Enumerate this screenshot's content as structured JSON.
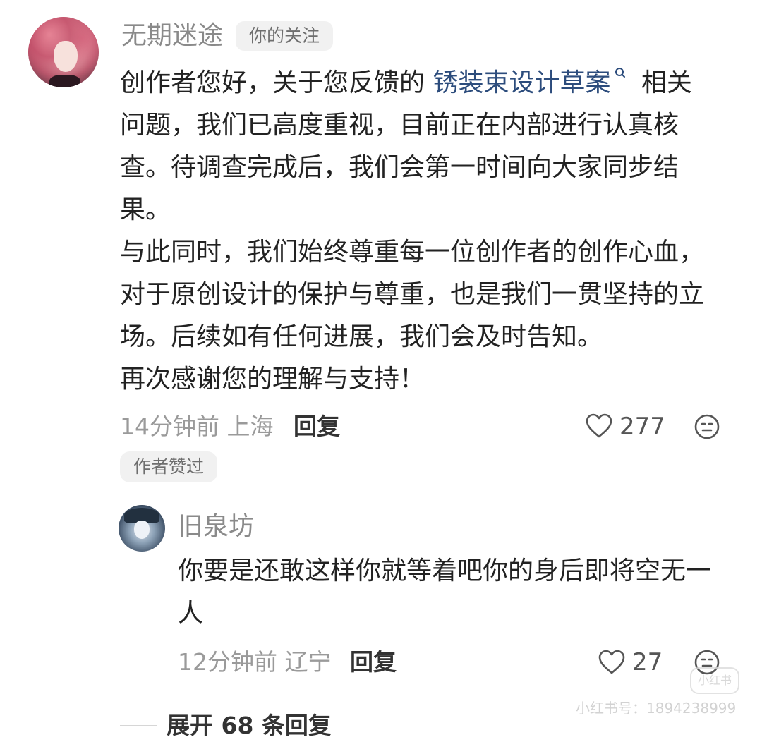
{
  "main_comment": {
    "username": "无期迷途",
    "follow_badge": "你的关注",
    "text_before_link": "创作者您好，关于您反馈的 ",
    "link_text": "锈装束设计草案",
    "text_after_link": " 相关问题，我们已高度重视，目前正在内部进行认真核查。待调查完成后，我们会第一时间向大家同步结果。",
    "paragraph_2": "与此同时，我们始终尊重每一位创作者的创作心血，对于原创设计的保护与尊重，也是我们一贯坚持的立场。后续如有任何进展，我们会及时告知。",
    "paragraph_3": "再次感谢您的理解与支持！",
    "time": "14分钟前",
    "location": "上海",
    "reply_label": "回复",
    "like_count": "277",
    "author_liked_badge": "作者赞过"
  },
  "reply_comment": {
    "username": "旧泉坊",
    "text": "你要是还敢这样你就等着吧你的身后即将空无一人",
    "time": "12分钟前",
    "location": "辽宁",
    "reply_label": "回复",
    "like_count": "27"
  },
  "expand": {
    "label": "展开 68 条回复"
  },
  "watermark": {
    "logo_text": "小红书",
    "id_text": "小红书号：1894238999"
  },
  "icons": {
    "like": "heart-outline-icon",
    "emoji": "neutral-face-icon",
    "search": "search-icon"
  },
  "colors": {
    "link": "#2c4c7c",
    "meta": "#9a9a9a",
    "text": "#222222"
  }
}
